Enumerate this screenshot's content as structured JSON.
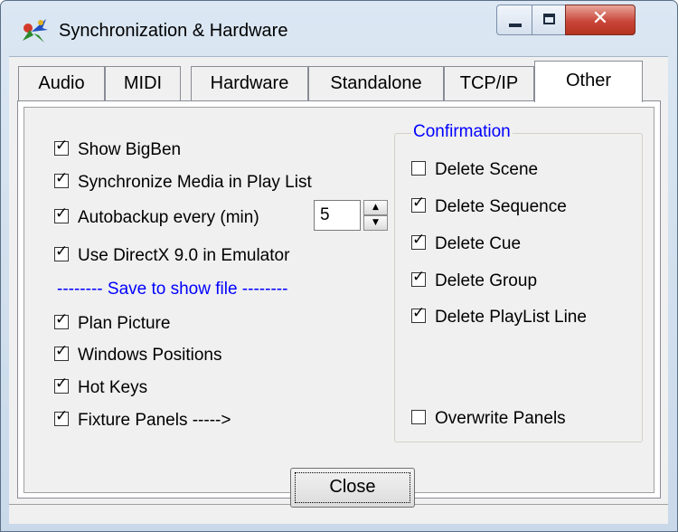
{
  "window": {
    "title": "Synchronization & Hardware",
    "icon": "app-icon",
    "controls": {
      "minimize": "minimize-icon",
      "maximize": "maximize-icon",
      "close": "close-icon"
    }
  },
  "tabs": [
    {
      "label": "Audio",
      "active": false
    },
    {
      "label": "MIDI",
      "active": false
    },
    {
      "label": "Hardware",
      "active": false
    },
    {
      "label": "Standalone",
      "active": false
    },
    {
      "label": "TCP/IP",
      "active": false
    },
    {
      "label": "Other",
      "active": true
    }
  ],
  "left_options": [
    {
      "label": "Show BigBen",
      "checked": true
    },
    {
      "label": "Synchronize Media in Play List",
      "checked": true
    },
    {
      "label": "Autobackup every (min)",
      "checked": true
    },
    {
      "label": "Use DirectX 9.0 in Emulator",
      "checked": true
    }
  ],
  "autobackup": {
    "value": "5"
  },
  "save_section": {
    "label": "-------- Save to show file --------",
    "options": [
      {
        "label": "Plan Picture",
        "checked": true
      },
      {
        "label": "Windows Positions",
        "checked": true
      },
      {
        "label": "Hot Keys",
        "checked": true
      },
      {
        "label": "Fixture Panels ----->",
        "checked": true
      }
    ]
  },
  "confirmation": {
    "title": "Confirmation",
    "options": [
      {
        "label": "Delete Scene",
        "checked": false
      },
      {
        "label": "Delete Sequence",
        "checked": true
      },
      {
        "label": "Delete Cue",
        "checked": true
      },
      {
        "label": "Delete Group",
        "checked": true
      },
      {
        "label": "Delete PlayList Line",
        "checked": true
      }
    ],
    "overwrite": {
      "label": "Overwrite Panels",
      "checked": false
    }
  },
  "footer": {
    "close_label": "Close"
  }
}
